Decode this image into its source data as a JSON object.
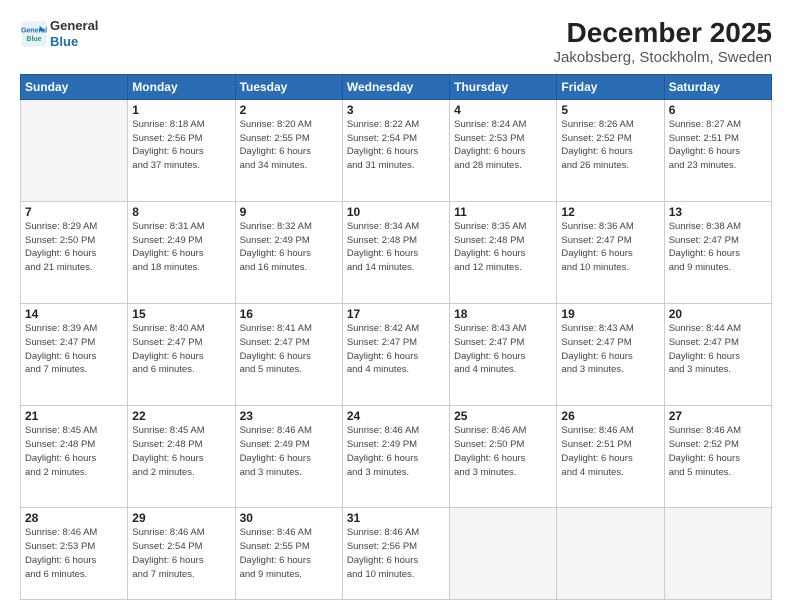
{
  "header": {
    "logo_line1": "General",
    "logo_line2": "Blue",
    "title": "December 2025",
    "subtitle": "Jakobsberg, Stockholm, Sweden"
  },
  "days_of_week": [
    "Sunday",
    "Monday",
    "Tuesday",
    "Wednesday",
    "Thursday",
    "Friday",
    "Saturday"
  ],
  "weeks": [
    [
      {
        "day": "",
        "info": ""
      },
      {
        "day": "1",
        "info": "Sunrise: 8:18 AM\nSunset: 2:56 PM\nDaylight: 6 hours\nand 37 minutes."
      },
      {
        "day": "2",
        "info": "Sunrise: 8:20 AM\nSunset: 2:55 PM\nDaylight: 6 hours\nand 34 minutes."
      },
      {
        "day": "3",
        "info": "Sunrise: 8:22 AM\nSunset: 2:54 PM\nDaylight: 6 hours\nand 31 minutes."
      },
      {
        "day": "4",
        "info": "Sunrise: 8:24 AM\nSunset: 2:53 PM\nDaylight: 6 hours\nand 28 minutes."
      },
      {
        "day": "5",
        "info": "Sunrise: 8:26 AM\nSunset: 2:52 PM\nDaylight: 6 hours\nand 26 minutes."
      },
      {
        "day": "6",
        "info": "Sunrise: 8:27 AM\nSunset: 2:51 PM\nDaylight: 6 hours\nand 23 minutes."
      }
    ],
    [
      {
        "day": "7",
        "info": "Sunrise: 8:29 AM\nSunset: 2:50 PM\nDaylight: 6 hours\nand 21 minutes."
      },
      {
        "day": "8",
        "info": "Sunrise: 8:31 AM\nSunset: 2:49 PM\nDaylight: 6 hours\nand 18 minutes."
      },
      {
        "day": "9",
        "info": "Sunrise: 8:32 AM\nSunset: 2:49 PM\nDaylight: 6 hours\nand 16 minutes."
      },
      {
        "day": "10",
        "info": "Sunrise: 8:34 AM\nSunset: 2:48 PM\nDaylight: 6 hours\nand 14 minutes."
      },
      {
        "day": "11",
        "info": "Sunrise: 8:35 AM\nSunset: 2:48 PM\nDaylight: 6 hours\nand 12 minutes."
      },
      {
        "day": "12",
        "info": "Sunrise: 8:36 AM\nSunset: 2:47 PM\nDaylight: 6 hours\nand 10 minutes."
      },
      {
        "day": "13",
        "info": "Sunrise: 8:38 AM\nSunset: 2:47 PM\nDaylight: 6 hours\nand 9 minutes."
      }
    ],
    [
      {
        "day": "14",
        "info": "Sunrise: 8:39 AM\nSunset: 2:47 PM\nDaylight: 6 hours\nand 7 minutes."
      },
      {
        "day": "15",
        "info": "Sunrise: 8:40 AM\nSunset: 2:47 PM\nDaylight: 6 hours\nand 6 minutes."
      },
      {
        "day": "16",
        "info": "Sunrise: 8:41 AM\nSunset: 2:47 PM\nDaylight: 6 hours\nand 5 minutes."
      },
      {
        "day": "17",
        "info": "Sunrise: 8:42 AM\nSunset: 2:47 PM\nDaylight: 6 hours\nand 4 minutes."
      },
      {
        "day": "18",
        "info": "Sunrise: 8:43 AM\nSunset: 2:47 PM\nDaylight: 6 hours\nand 4 minutes."
      },
      {
        "day": "19",
        "info": "Sunrise: 8:43 AM\nSunset: 2:47 PM\nDaylight: 6 hours\nand 3 minutes."
      },
      {
        "day": "20",
        "info": "Sunrise: 8:44 AM\nSunset: 2:47 PM\nDaylight: 6 hours\nand 3 minutes."
      }
    ],
    [
      {
        "day": "21",
        "info": "Sunrise: 8:45 AM\nSunset: 2:48 PM\nDaylight: 6 hours\nand 2 minutes."
      },
      {
        "day": "22",
        "info": "Sunrise: 8:45 AM\nSunset: 2:48 PM\nDaylight: 6 hours\nand 2 minutes."
      },
      {
        "day": "23",
        "info": "Sunrise: 8:46 AM\nSunset: 2:49 PM\nDaylight: 6 hours\nand 3 minutes."
      },
      {
        "day": "24",
        "info": "Sunrise: 8:46 AM\nSunset: 2:49 PM\nDaylight: 6 hours\nand 3 minutes."
      },
      {
        "day": "25",
        "info": "Sunrise: 8:46 AM\nSunset: 2:50 PM\nDaylight: 6 hours\nand 3 minutes."
      },
      {
        "day": "26",
        "info": "Sunrise: 8:46 AM\nSunset: 2:51 PM\nDaylight: 6 hours\nand 4 minutes."
      },
      {
        "day": "27",
        "info": "Sunrise: 8:46 AM\nSunset: 2:52 PM\nDaylight: 6 hours\nand 5 minutes."
      }
    ],
    [
      {
        "day": "28",
        "info": "Sunrise: 8:46 AM\nSunset: 2:53 PM\nDaylight: 6 hours\nand 6 minutes."
      },
      {
        "day": "29",
        "info": "Sunrise: 8:46 AM\nSunset: 2:54 PM\nDaylight: 6 hours\nand 7 minutes."
      },
      {
        "day": "30",
        "info": "Sunrise: 8:46 AM\nSunset: 2:55 PM\nDaylight: 6 hours\nand 9 minutes."
      },
      {
        "day": "31",
        "info": "Sunrise: 8:46 AM\nSunset: 2:56 PM\nDaylight: 6 hours\nand 10 minutes."
      },
      {
        "day": "",
        "info": ""
      },
      {
        "day": "",
        "info": ""
      },
      {
        "day": "",
        "info": ""
      }
    ]
  ]
}
